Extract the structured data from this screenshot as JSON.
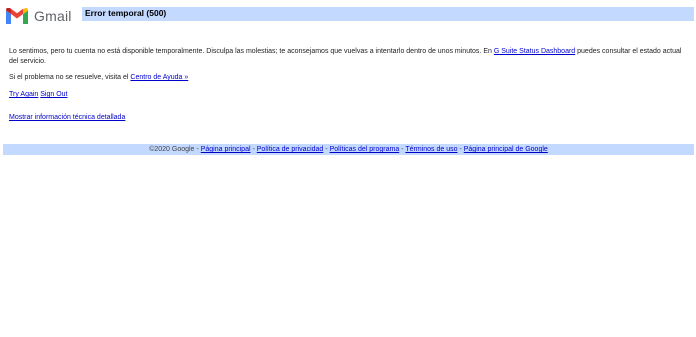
{
  "logo": {
    "text": "Gmail",
    "icon": "gmail-m-icon",
    "colors": [
      "#4285f4",
      "#ea4335",
      "#fbbc05",
      "#34a853",
      "#c5221f"
    ]
  },
  "title": "Error temporal (500)",
  "message": {
    "main": "Lo sentimos, pero tu cuenta no está disponible temporalmente. Disculpa las molestias; te aconsejamos que vuelvas a intentarlo dentro de unos minutos.",
    "en": "En",
    "status_link": "G Suite Status Dashboard",
    "status_tail": "puedes consultar el estado actual del servicio."
  },
  "help": {
    "prefix": "Si el problema no se resuelve, visita el",
    "link": "Centro de Ayuda »"
  },
  "actions": {
    "try_again": "Try Again",
    "sign_out": "Sign Out"
  },
  "tech_link": "Mostrar información técnica detallada",
  "footer": {
    "copyright": "©2020 Google",
    "separator": "-",
    "links": [
      "Página principal",
      "Política de privacidad",
      "Políticas del programa",
      "Términos de uso",
      "Página principal de Google"
    ]
  },
  "colors": {
    "bar": "#c3d9ff",
    "link": "#0000cc"
  }
}
